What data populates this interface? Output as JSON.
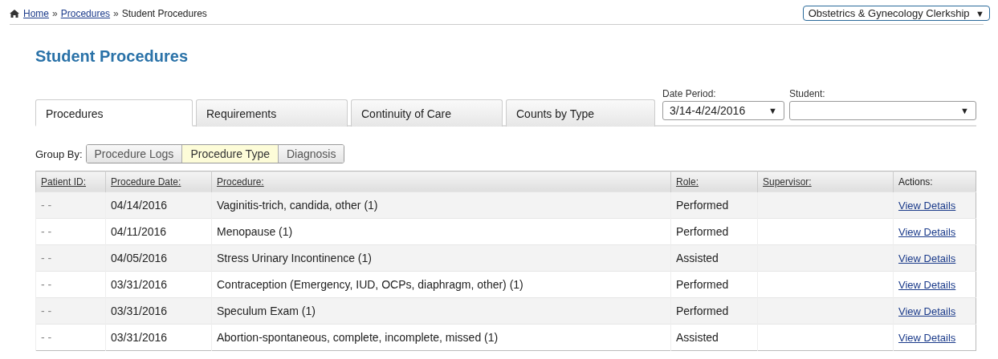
{
  "breadcrumb": [
    {
      "label": "Home",
      "link": true
    },
    {
      "label": "Procedures",
      "link": true
    },
    {
      "label": "Student Procedures",
      "link": false
    }
  ],
  "separator": "»",
  "clerkship_select": {
    "value": "Obstetrics & Gynecology Clerkship",
    "arrow": "▼"
  },
  "title": "Student Procedures",
  "tabs": [
    {
      "label": "Procedures",
      "selected": true
    },
    {
      "label": "Requirements",
      "selected": false
    },
    {
      "label": "Continuity of Care",
      "selected": false
    },
    {
      "label": "Counts by Type",
      "selected": false
    }
  ],
  "filters": [
    {
      "label": "Date Period:",
      "value": "3/14-4/24/2016",
      "arrow": "▼"
    },
    {
      "label": "Student:",
      "arrow": "▼"
    }
  ],
  "group_by": {
    "label": "Group By:",
    "options": [
      {
        "label": "Procedure Logs",
        "selected": false
      },
      {
        "label": "Procedure Type",
        "selected": true
      },
      {
        "label": "Diagnosis",
        "selected": false
      }
    ]
  },
  "table": {
    "columns": [
      {
        "label": "Patient ID:",
        "sortable": true
      },
      {
        "label": "Procedure Date:",
        "sortable": true
      },
      {
        "label": "Procedure:",
        "sortable": true
      },
      {
        "label": "Role:",
        "sortable": true
      },
      {
        "label": "Supervisor:",
        "sortable": true
      },
      {
        "label": "Actions:",
        "sortable": false
      }
    ],
    "rows": [
      {
        "patient_id": "- -",
        "date": "04/14/2016",
        "procedure": "Vaginitis-trich, candida, other (1)",
        "role": "Performed",
        "action": "View Details"
      },
      {
        "patient_id": "- -",
        "date": "04/11/2016",
        "procedure": "Menopause (1)",
        "role": "Performed",
        "action": "View Details"
      },
      {
        "patient_id": "- -",
        "date": "04/05/2016",
        "procedure": "Stress Urinary Incontinence (1)",
        "role": "Assisted",
        "action": "View Details"
      },
      {
        "patient_id": "- -",
        "date": "03/31/2016",
        "procedure": "Contraception (Emergency, IUD, OCPs, diaphragm, other) (1)",
        "role": "Performed",
        "action": "View Details"
      },
      {
        "patient_id": "- -",
        "date": "03/31/2016",
        "procedure": "Speculum Exam (1)",
        "role": "Performed",
        "action": "View Details"
      },
      {
        "patient_id": "- -",
        "date": "03/31/2016",
        "procedure": "Abortion-spontaneous, complete, incomplete, missed (1)",
        "role": "Assisted",
        "action": "View Details"
      }
    ]
  }
}
